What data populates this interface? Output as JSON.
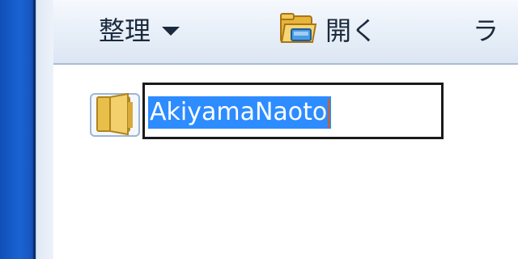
{
  "toolbar": {
    "organize_label": "整理",
    "open_label": "開く",
    "library_label_partial": "ラ"
  },
  "rename": {
    "value": "AkiyamaNaoto"
  },
  "icons": {
    "organize_dropdown": "chevron-down-icon",
    "open": "folder-open-icon",
    "item": "folder-icon"
  },
  "colors": {
    "selection": "#2d8cff",
    "caret": "#e05a00",
    "frame_blue": "#1a63d4"
  }
}
